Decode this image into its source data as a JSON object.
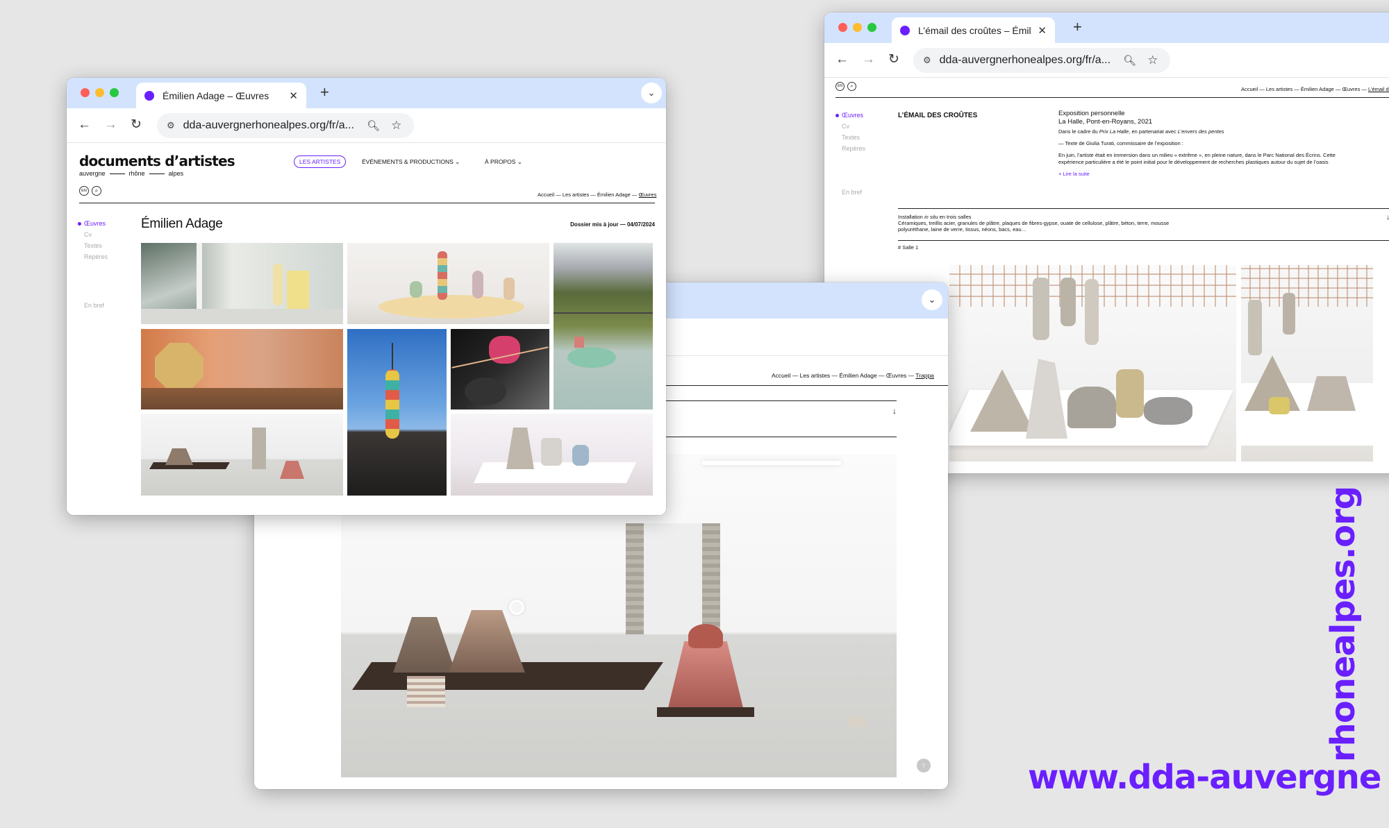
{
  "brand_color": "#6a1fff",
  "back_window": {
    "tab_title": "L’émail des croûtes – Émilien",
    "url": "dda-auvergnerhonealpes.org/fr/a...",
    "lang": "EN",
    "breadcrumb": [
      "Accueil",
      "Les artistes",
      "Émilien Adage",
      "Œuvres",
      "L’émail des"
    ],
    "nav": [
      "Œuvres",
      "Cv",
      "Textes",
      "Repères",
      "En bref"
    ],
    "work_title": "L’ÉMAIL DES CROÛTES",
    "exhibition_type": "Exposition personnelle",
    "venue": "La Halle, Pont-en-Royans, 2021",
    "context_prefix": "Dans le cadre du ",
    "context_prize": "Prix La Halle",
    "context_mid": ", en partenariat avec ",
    "context_partner": "L’envers des pentes",
    "text_credit": "— Texte de Giulia Turati, commissaire de l’exposition :",
    "text_body": "En juin, l’artiste était en immersion dans un milieu « extrême », en pleine nature, dans le Parc National des Écrins. Cette expérience particulière a été le point initial pour le développement de recherches plastiques autour du sujet de l’oasis",
    "read_more": "+ Lire la suite",
    "install_prefix": "Installation ",
    "install_em": "in situ",
    "install_suffix": " en trois salles",
    "materials": "Céramiques, treillis acier, granules de plâtre, plaques de fibres-gypse, ouate de cellulose, plâtre, béton, terre, mousse polyuréthane, laine de verre, tissus, néons, bacs, eau…",
    "room_label": "# Salle 1"
  },
  "middle_window": {
    "breadcrumb": [
      "Accueil",
      "Les artistes",
      "Émilien Adage",
      "Œuvres",
      "Trappa"
    ]
  },
  "front_window": {
    "tab_title": "Émilien Adage – Œuvres",
    "url": "dda-auvergnerhonealpes.org/fr/a...",
    "logo_title": "documents d’artistes",
    "logo_sub": [
      "auvergne",
      "rhône",
      "alpes"
    ],
    "menu_artists": "LES ARTISTES",
    "menu_events": "ÉVÉNEMENTS & PRODUCTIONS",
    "menu_about": "À PROPOS",
    "lang": "EN",
    "breadcrumb": [
      "Accueil",
      "Les artistes",
      "Émilien Adage",
      "Œuvres"
    ],
    "nav": [
      "Œuvres",
      "Cv",
      "Textes",
      "Repères",
      "En bref"
    ],
    "artist_name": "Émilien Adage",
    "updated": "Dossier mis à jour — 04/07/2024"
  },
  "watermark": {
    "line1": "www.dda-auvergne",
    "line2": "rhonealpes.org"
  }
}
